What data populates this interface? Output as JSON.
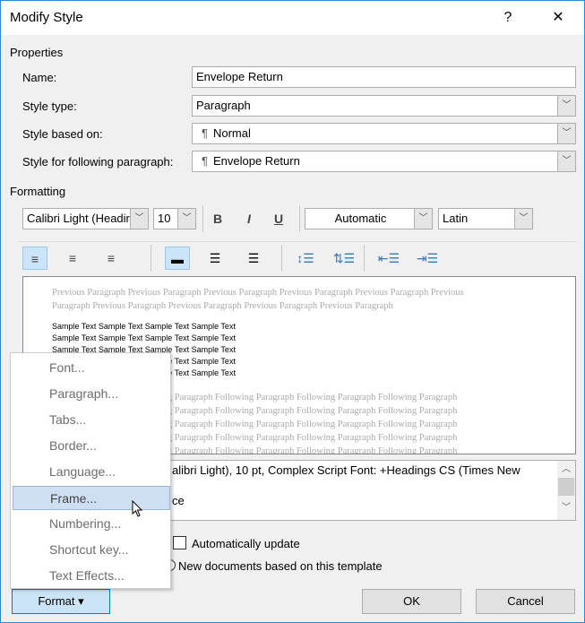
{
  "title": "Modify Style",
  "help": "?",
  "close": "✕",
  "properties": {
    "label": "Properties",
    "name_label": "Name:",
    "name_value": "Envelope Return",
    "type_label": "Style type:",
    "type_value": "Paragraph",
    "based_label": "Style based on:",
    "based_value": "Normal",
    "following_label": "Style for following paragraph:",
    "following_value": "Envelope Return",
    "para_mark": "¶"
  },
  "formatting": {
    "label": "Formatting",
    "font": "Calibri Light (Headir",
    "size": "10",
    "bold": "B",
    "italic": "I",
    "underline": "U",
    "color": "Automatic",
    "script": "Latin"
  },
  "preview": {
    "previous": [
      "Previous Paragraph Previous Paragraph Previous Paragraph Previous Paragraph Previous Paragraph Previous",
      "Paragraph Previous Paragraph Previous Paragraph Previous Paragraph Previous Paragraph"
    ],
    "sample": [
      "Sample Text Sample Text Sample Text Sample Text",
      "Sample Text Sample Text Sample Text Sample Text",
      "Sample Text Sample Text Sample Text Sample Text",
      "Sample Text Sample Text Sample Text Sample Text",
      "Sample Text Sample Text Sample Text Sample Text"
    ],
    "following": [
      "Following Paragraph Following Paragraph Following Paragraph Following Paragraph Following Paragraph",
      "Following Paragraph Following Paragraph Following Paragraph Following Paragraph Following Paragraph",
      "Following Paragraph Following Paragraph Following Paragraph Following Paragraph Following Paragraph",
      "Following Paragraph Following Paragraph Following Paragraph Following Paragraph Following Paragraph",
      "Following Paragraph Following Paragraph Following Paragraph Following Paragraph Following Paragraph"
    ]
  },
  "description": {
    "line1": "alibri Light), 10 pt, Complex Script Font: +Headings CS (Times New",
    "line2": "ce"
  },
  "auto_update": {
    "label": "Automatically update",
    "checked": false
  },
  "new_docs": {
    "label": "New documents based on this template"
  },
  "buttons": {
    "format": "Format ▾",
    "ok": "OK",
    "cancel": "Cancel"
  },
  "menu": {
    "items": [
      {
        "label": "Font..."
      },
      {
        "label": "Paragraph..."
      },
      {
        "label": "Tabs..."
      },
      {
        "label": "Border..."
      },
      {
        "label": "Language..."
      },
      {
        "label": "Frame...",
        "highlighted": true
      },
      {
        "label": "Numbering..."
      },
      {
        "label": "Shortcut key..."
      },
      {
        "label": "Text Effects..."
      }
    ]
  }
}
